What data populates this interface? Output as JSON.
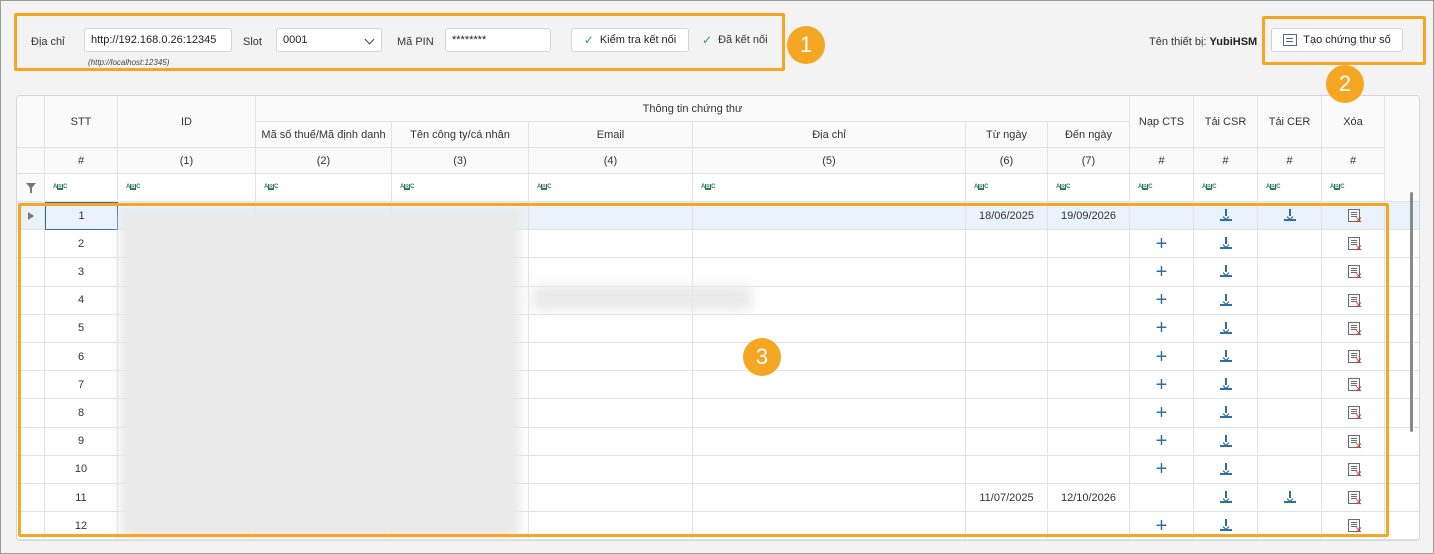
{
  "toolbar": {
    "address_label": "Địa chỉ",
    "address_value": "http://192.168.0.26:12345",
    "address_hint": "(http://localhost:12345)",
    "slot_label": "Slot",
    "slot_value": "0001",
    "pin_label": "Mã PIN",
    "pin_value": "********",
    "check_button": "Kiểm tra kết nối",
    "connected_status": "Đã kết nối",
    "device_label": "Tên thiết bị:",
    "device_name": "YubiHSM",
    "create_cert_button": "Tạo chứng thư số"
  },
  "badges": [
    "1",
    "2",
    "3"
  ],
  "grid": {
    "group_header": "Thông tin chứng thư",
    "columns": [
      {
        "key": "stt",
        "label": "STT",
        "index": "#"
      },
      {
        "key": "id",
        "label": "ID",
        "index": "(1)"
      },
      {
        "key": "tax",
        "label": "Mã số thuế/Mã định danh",
        "index": "(2)"
      },
      {
        "key": "name",
        "label": "Tên công ty/cá nhân",
        "index": "(3)"
      },
      {
        "key": "email",
        "label": "Email",
        "index": "(4)"
      },
      {
        "key": "address",
        "label": "Địa chỉ",
        "index": "(5)"
      },
      {
        "key": "from",
        "label": "Từ ngày",
        "index": "(6)"
      },
      {
        "key": "to",
        "label": "Đến ngày",
        "index": "(7)"
      },
      {
        "key": "load",
        "label": "Nạp CTS",
        "index": "#"
      },
      {
        "key": "csr",
        "label": "Tải CSR",
        "index": "#"
      },
      {
        "key": "cer",
        "label": "Tải CER",
        "index": "#"
      },
      {
        "key": "del",
        "label": "Xóa",
        "index": "#"
      }
    ],
    "filter_glyph": "ABC",
    "rows": [
      {
        "stt": "1",
        "from": "18/06/2025",
        "to": "19/09/2026",
        "load": false,
        "csr": true,
        "cer": true
      },
      {
        "stt": "2",
        "from": "",
        "to": "",
        "load": true,
        "csr": true,
        "cer": false
      },
      {
        "stt": "3",
        "from": "",
        "to": "",
        "load": true,
        "csr": true,
        "cer": false
      },
      {
        "stt": "4",
        "from": "",
        "to": "",
        "load": true,
        "csr": true,
        "cer": false
      },
      {
        "stt": "5",
        "from": "",
        "to": "",
        "load": true,
        "csr": true,
        "cer": false
      },
      {
        "stt": "6",
        "from": "",
        "to": "",
        "load": true,
        "csr": true,
        "cer": false
      },
      {
        "stt": "7",
        "from": "",
        "to": "",
        "load": true,
        "csr": true,
        "cer": false
      },
      {
        "stt": "8",
        "from": "",
        "to": "",
        "load": true,
        "csr": true,
        "cer": false
      },
      {
        "stt": "9",
        "from": "",
        "to": "",
        "load": true,
        "csr": true,
        "cer": false
      },
      {
        "stt": "10",
        "from": "",
        "to": "",
        "load": true,
        "csr": true,
        "cer": false
      },
      {
        "stt": "11",
        "from": "11/07/2025",
        "to": "12/10/2026",
        "load": false,
        "csr": true,
        "cer": true
      },
      {
        "stt": "12",
        "from": "",
        "to": "",
        "load": true,
        "csr": true,
        "cer": false
      }
    ]
  },
  "colors": {
    "highlight": "#f5a623",
    "accent": "#2f6fa8",
    "check": "#4a8a7a",
    "delete": "#d9342b"
  }
}
